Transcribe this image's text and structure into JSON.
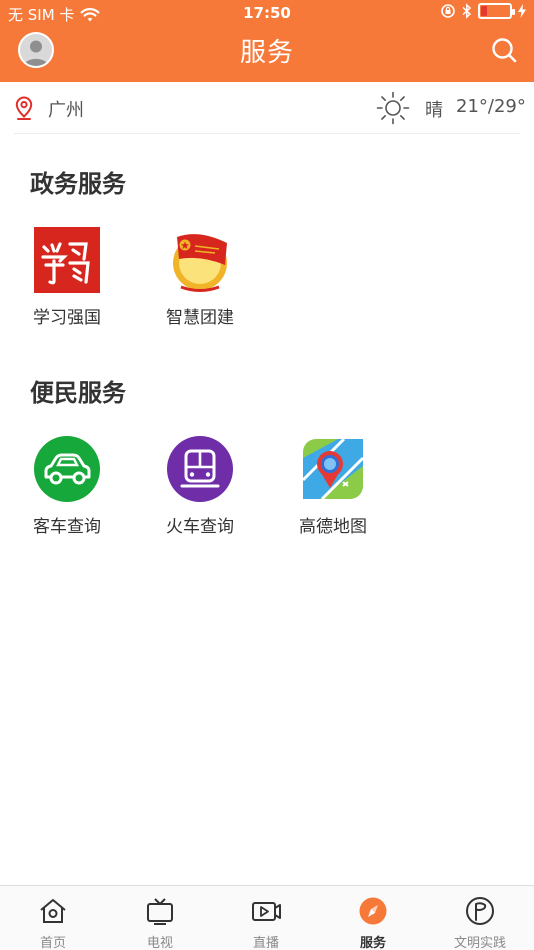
{
  "status_bar": {
    "carrier": "无 SIM 卡",
    "time": "17:50",
    "battery_level": 0.2
  },
  "nav": {
    "title": "服务"
  },
  "location": {
    "city": "广州"
  },
  "weather": {
    "condition": "晴",
    "temperature": "21°/29°"
  },
  "sections": [
    {
      "title": "政务服务",
      "items": [
        {
          "label": "学习强国",
          "icon": "xuexi-qiangguo-icon"
        },
        {
          "label": "智慧团建",
          "icon": "youth-league-icon"
        }
      ]
    },
    {
      "title": "便民服务",
      "items": [
        {
          "label": "客车查询",
          "icon": "car-icon"
        },
        {
          "label": "火车查询",
          "icon": "train-icon"
        },
        {
          "label": "高德地图",
          "icon": "amap-icon"
        }
      ]
    }
  ],
  "tabs": [
    {
      "label": "首页",
      "icon": "home-icon"
    },
    {
      "label": "电视",
      "icon": "tv-icon"
    },
    {
      "label": "直播",
      "icon": "live-video-icon"
    },
    {
      "label": "服务",
      "icon": "compass-icon",
      "active": true
    },
    {
      "label": "文明实践",
      "icon": "flag-circle-icon"
    }
  ],
  "colors": {
    "brand": "#F7793A",
    "car_green": "#16A83A",
    "train_purple": "#6F2DA8",
    "xuexi_red": "#D7261E"
  }
}
